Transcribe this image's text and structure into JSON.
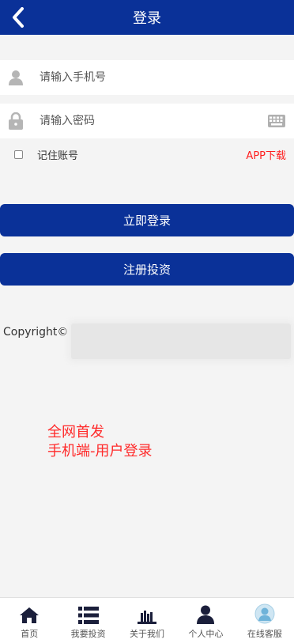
{
  "header": {
    "title": "登录",
    "back_icon": "chevron-left-icon"
  },
  "form": {
    "phone_placeholder": "请输入手机号",
    "password_placeholder": "请输入密码",
    "remember_label": "记住账号",
    "app_download_label": "APP下载"
  },
  "buttons": {
    "login_label": "立即登录",
    "register_label": "注册投资"
  },
  "footer": {
    "copyright_label": "Copyright©"
  },
  "promo": {
    "line1": "全网首发",
    "line2": "手机端-用户登录"
  },
  "tabbar": {
    "items": [
      {
        "label": "首页",
        "icon": "home-icon"
      },
      {
        "label": "我要投资",
        "icon": "list-icon"
      },
      {
        "label": "关于我们",
        "icon": "bookshelf-icon"
      },
      {
        "label": "个人中心",
        "icon": "user-icon"
      },
      {
        "label": "在线客服",
        "icon": "support-avatar-icon"
      }
    ]
  },
  "colors": {
    "brand": "#0a3198",
    "accent_red": "#ff1f1f",
    "background": "#f4f4f4"
  }
}
